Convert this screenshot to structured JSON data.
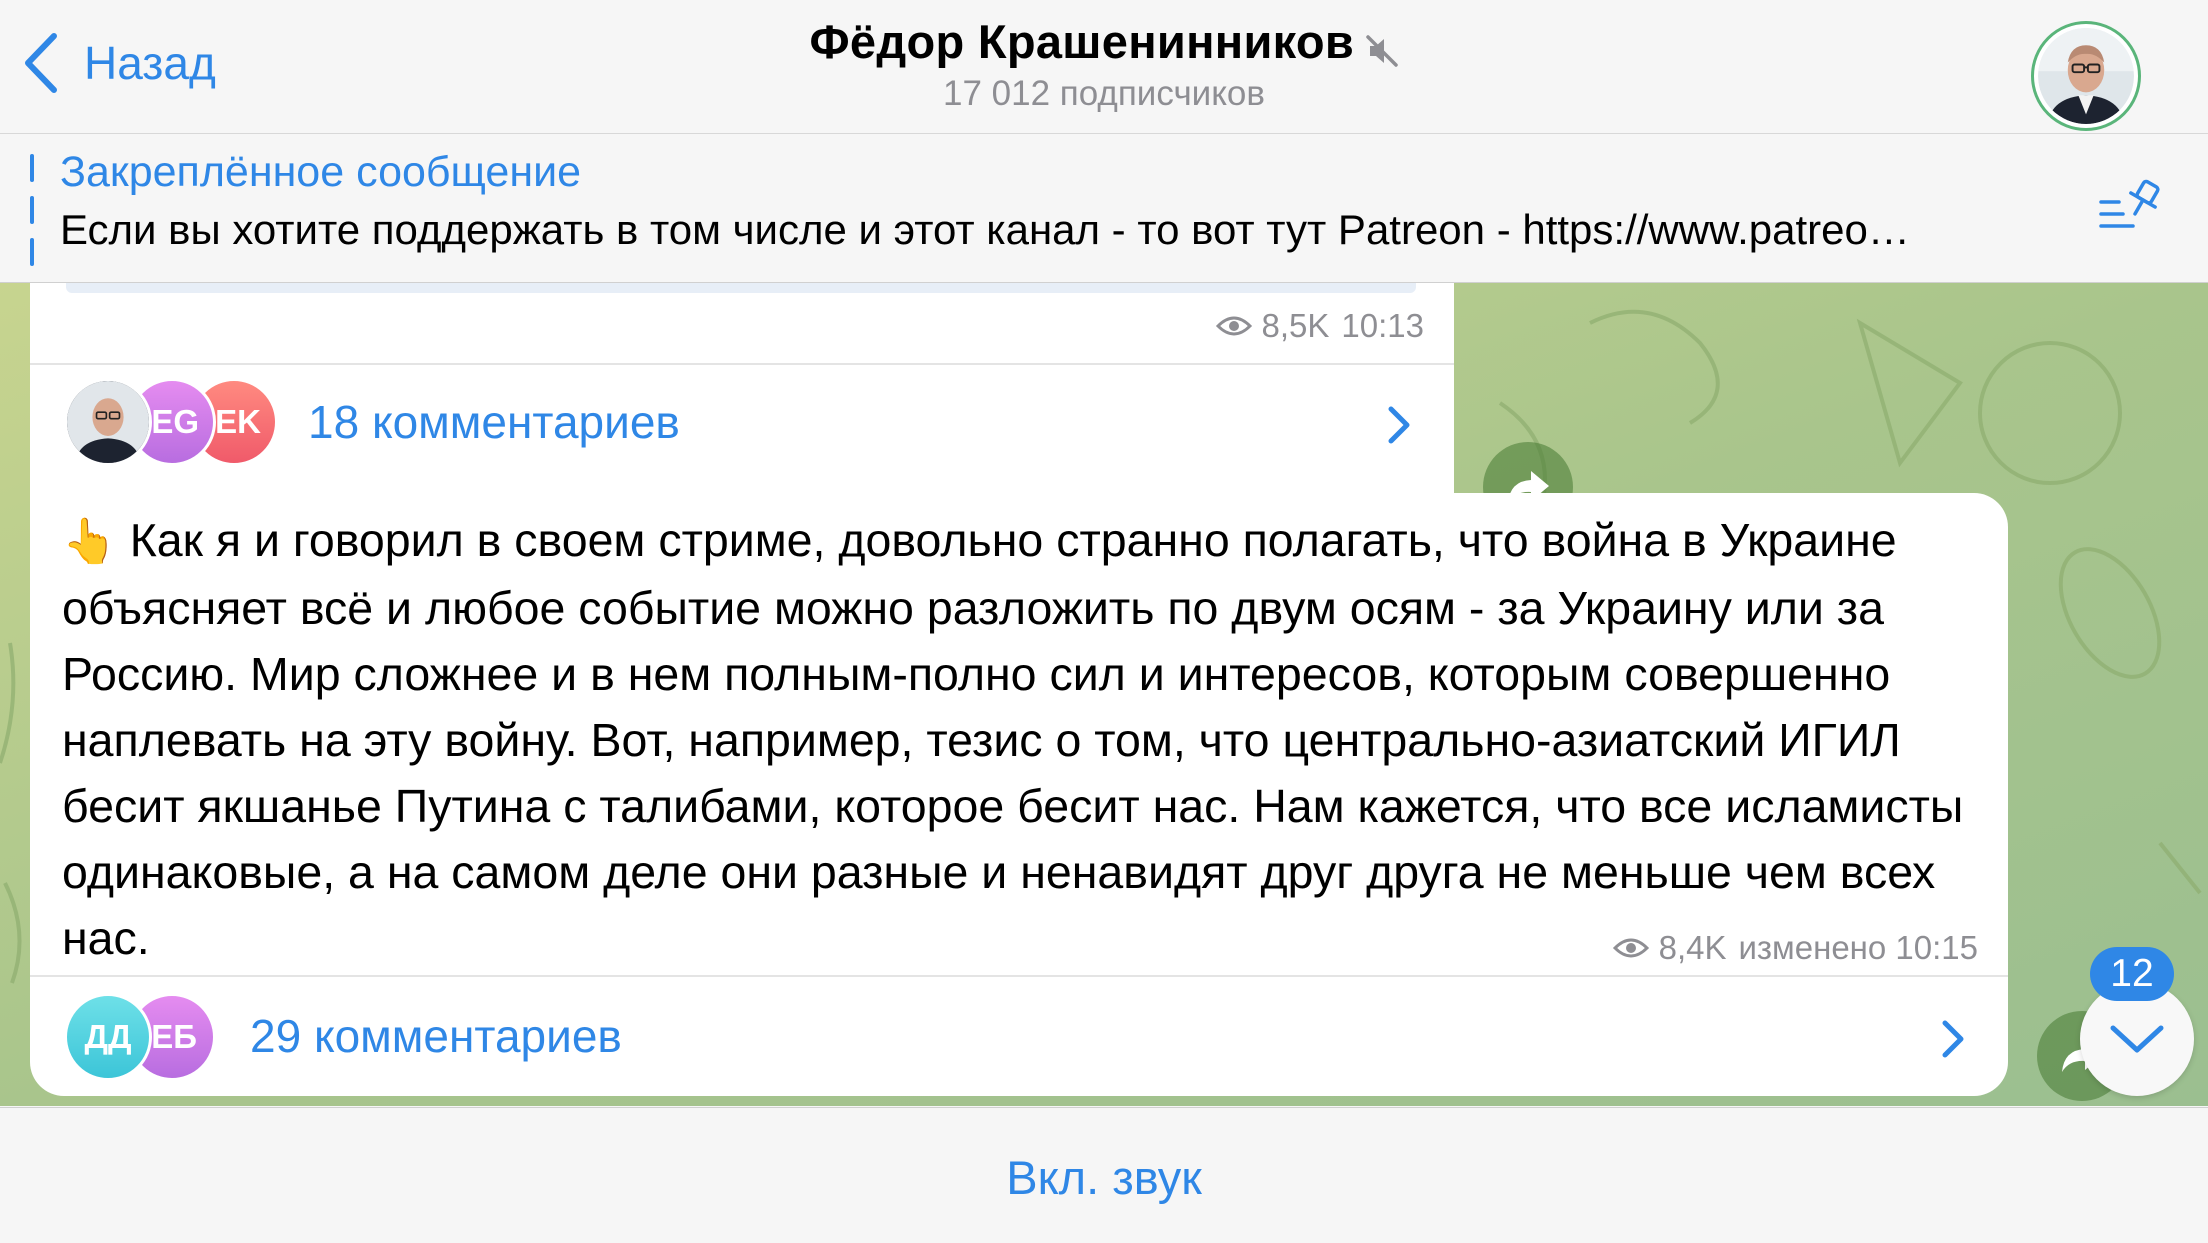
{
  "header": {
    "back_label": "Назад",
    "title": "Фёдор Крашенинников",
    "subtitle": "17 012 подписчиков",
    "muted_icon": "speaker-muted-icon",
    "avatar": "channel-avatar"
  },
  "pinned": {
    "title": "Закреплённое сообщение",
    "text": "Если вы хотите поддержать в том числе и этот канал - то вот тут Patreon - https://www.patreo…",
    "icon": "pinned-list-icon"
  },
  "messages": [
    {
      "views": "8,5K",
      "time": "10:13",
      "comments_label": "18 комментариев",
      "comment_avatars": [
        {
          "initials": "",
          "kind": "photo"
        },
        {
          "initials": "EG",
          "color_from": "#e58cf0",
          "color_to": "#b86de0"
        },
        {
          "initials": "EK",
          "color_from": "#ff8a80",
          "color_to": "#f05a6a"
        }
      ]
    },
    {
      "emoji": "👆",
      "text": "Как я и говорил в своем стриме, довольно странно полагать, что война в Украине объясняет всё и любое событие можно разложить по двум осям - за Украину или за Россию. Мир сложнее и в нем полным-полно сил и интересов, которым совершенно наплевать на эту войну. Вот, например, тезис о том, что центрально-азиатский ИГИЛ бесит якшанье Путина с талибами, которое бесит нас. Нам кажется, что все исламисты одинаковые, а на самом деле они разные и ненавидят друг друга не меньше чем всех нас.",
      "views": "8,4K",
      "edited_time": "изменено 10:15",
      "comments_label": "29 комментариев",
      "comment_avatars": [
        {
          "initials": "ДД",
          "color_from": "#6ee0e8",
          "color_to": "#3cc5d8"
        },
        {
          "initials": "ЕБ",
          "color_from": "#e58cf0",
          "color_to": "#b86de0"
        }
      ]
    }
  ],
  "unread_badge": "12",
  "bottom": {
    "unmute_label": "Вкл. звук"
  },
  "colors": {
    "accent": "#2f87e6",
    "chat_bg": "#b5c98a",
    "meta": "#8e8e93"
  }
}
